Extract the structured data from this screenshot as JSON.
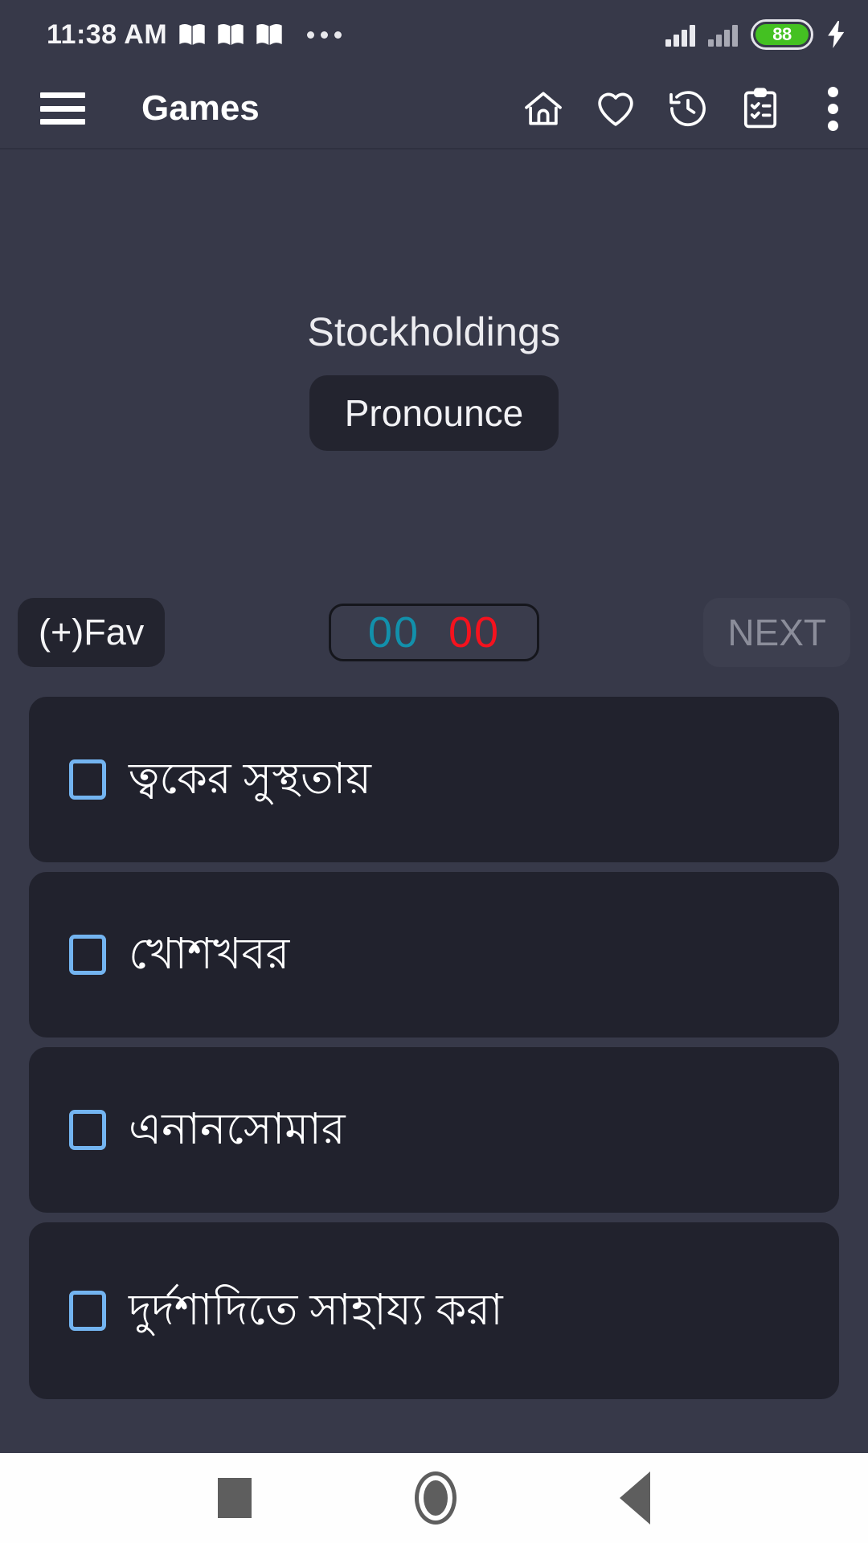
{
  "status_bar": {
    "time": "11:38 AM",
    "notification_icons": [
      "book-icon",
      "book-icon",
      "book-icon"
    ],
    "overflow_icon": "more-dots-icon",
    "signal_icons": [
      "signal-bars-icon",
      "signal-bars-icon"
    ],
    "battery_level": "88",
    "battery_color": "#44c122",
    "charging_icon": "lightning-bolt-icon"
  },
  "app_bar": {
    "menu_icon": "hamburger-menu-icon",
    "title": "Games",
    "actions": [
      {
        "name": "home-icon",
        "label": "Home"
      },
      {
        "name": "heart-icon",
        "label": "Favorites"
      },
      {
        "name": "history-icon",
        "label": "History"
      },
      {
        "name": "clipboard-checklist-icon",
        "label": "Tests"
      }
    ],
    "overflow_icon": "kebab-menu-icon"
  },
  "main": {
    "word": "Stockholdings",
    "pronounce_label": "Pronounce",
    "fav_label": "(+)Fav",
    "next_label": "NEXT",
    "score": {
      "correct": "00",
      "wrong": "00",
      "correct_color": "#1290ab",
      "wrong_color": "#f5121e"
    },
    "options": [
      {
        "text": "ত্বকের সুস্থতায়",
        "checked": false
      },
      {
        "text": "খোশখবর",
        "checked": false
      },
      {
        "text": "এনানসোমার",
        "checked": false
      },
      {
        "text": "দুর্দশাদিতে সাহায্য করা",
        "checked": false
      }
    ]
  },
  "nav_bar": {
    "recent_icon": "square-recents-icon",
    "home_icon": "circle-home-icon",
    "back_icon": "triangle-back-icon"
  },
  "colors": {
    "page_background": "#373949",
    "card_background": "#21222d",
    "button_background": "#23242f",
    "checkbox_border": "#73b4f0",
    "next_text": "#8b8d9a"
  }
}
